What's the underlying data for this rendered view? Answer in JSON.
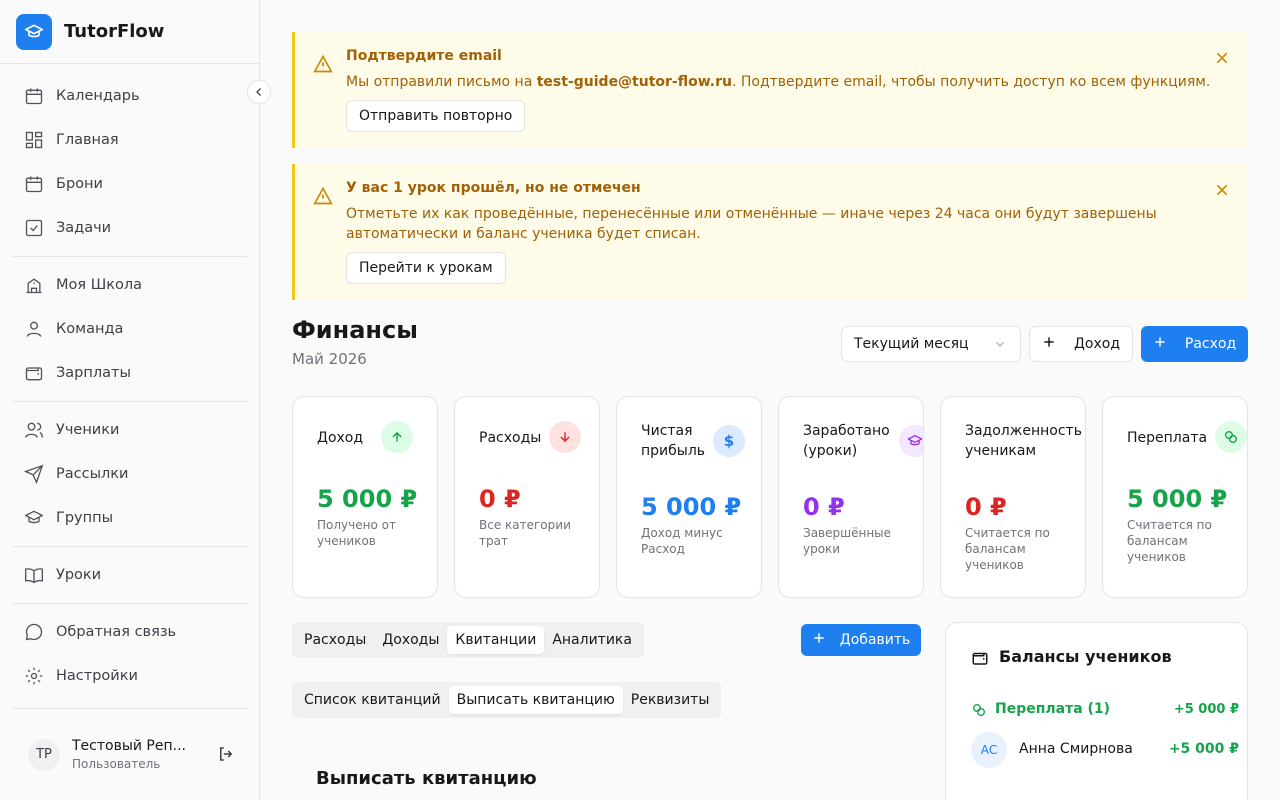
{
  "app": {
    "name": "TutorFlow"
  },
  "sidebar": {
    "items": [
      {
        "label": "Календарь",
        "icon": "calendar-icon"
      },
      {
        "label": "Главная",
        "icon": "dashboard-icon"
      },
      {
        "label": "Брони",
        "icon": "calendar-icon"
      },
      {
        "label": "Задачи",
        "icon": "checkbox-icon"
      },
      {
        "label": "Моя Школа",
        "icon": "school-icon"
      },
      {
        "label": "Команда",
        "icon": "user-icon"
      },
      {
        "label": "Зарплаты",
        "icon": "wallet-icon"
      },
      {
        "label": "Ученики",
        "icon": "users-icon"
      },
      {
        "label": "Рассылки",
        "icon": "send-icon"
      },
      {
        "label": "Группы",
        "icon": "graduation-cap-icon"
      },
      {
        "label": "Уроки",
        "icon": "book-icon"
      },
      {
        "label": "Обратная связь",
        "icon": "chat-icon"
      },
      {
        "label": "Настройки",
        "icon": "gear-icon"
      }
    ],
    "user": {
      "initials": "ТР",
      "name": "Тестовый Реп...",
      "role": "Пользователь"
    }
  },
  "alerts": [
    {
      "title": "Подтвердите email",
      "text_before": "Мы отправили письмо на ",
      "email": "test-guide@tutor-flow.ru",
      "text_after": ". Подтвердите email, чтобы получить доступ ко всем функциям.",
      "button": "Отправить повторно"
    },
    {
      "title": "У вас 1 урок прошёл, но не отмечен",
      "text": "Отметьте их как проведённые, перенесённые или отменённые — иначе через 24 часа они будут завершены автоматически и баланс ученика будет списан.",
      "button": "Перейти к урокам"
    }
  ],
  "header": {
    "title": "Финансы",
    "subtitle": "Май 2026",
    "period_select": "Текущий месяц",
    "income_button": "Доход",
    "expense_button": "Расход"
  },
  "cards": [
    {
      "label": "Доход",
      "value": "5 000 ₽",
      "desc": "Получено от учеников",
      "color": "#16a34a",
      "icon": "arrow-up-icon",
      "icon_bg": "#dcfce7",
      "icon_color": "#16a34a"
    },
    {
      "label": "Расходы",
      "value": "0 ₽",
      "desc": "Все категории трат",
      "color": "#dc2626",
      "icon": "arrow-down-icon",
      "icon_bg": "#fee2e2",
      "icon_color": "#dc2626"
    },
    {
      "label": "Чистая прибыль",
      "value": "5 000 ₽",
      "desc": "Доход минус Расход",
      "color": "#1d7ff0",
      "icon": "dollar-icon",
      "icon_bg": "#dbeafe",
      "icon_color": "#1d7ff0"
    },
    {
      "label": "Заработано (уроки)",
      "value": "0 ₽",
      "desc": "Завершённые уроки",
      "color": "#9333ea",
      "icon": "graduation-cap-icon",
      "icon_bg": "#f3e8ff",
      "icon_color": "#9333ea"
    },
    {
      "label": "Задолженность ученикам",
      "value": "0 ₽",
      "desc": "Считается по балансам учеников",
      "color": "#dc2626",
      "icon": "alert-circle-icon",
      "icon_bg": "#fee2e2",
      "icon_color": "#dc2626"
    },
    {
      "label": "Переплата",
      "value": "5 000 ₽",
      "desc": "Считается по балансам учеников",
      "color": "#16a34a",
      "icon": "coins-icon",
      "icon_bg": "#dcfce7",
      "icon_color": "#16a34a"
    }
  ],
  "tabs": [
    "Расходы",
    "Доходы",
    "Квитанции",
    "Аналитика"
  ],
  "active_tab": "Квитанции",
  "add_button": "Добавить",
  "subtabs": [
    "Список квитанций",
    "Выписать квитанцию",
    "Реквизиты"
  ],
  "active_subtab": "Выписать квитанцию",
  "section_title": "Выписать квитанцию",
  "balances": {
    "title": "Балансы учеников",
    "group_label": "Переплата (1)",
    "group_sum": "+5 000 ₽",
    "students": [
      {
        "initials": "АС",
        "name": "Анна Смирнова",
        "amount": "+5 000 ₽"
      }
    ]
  }
}
